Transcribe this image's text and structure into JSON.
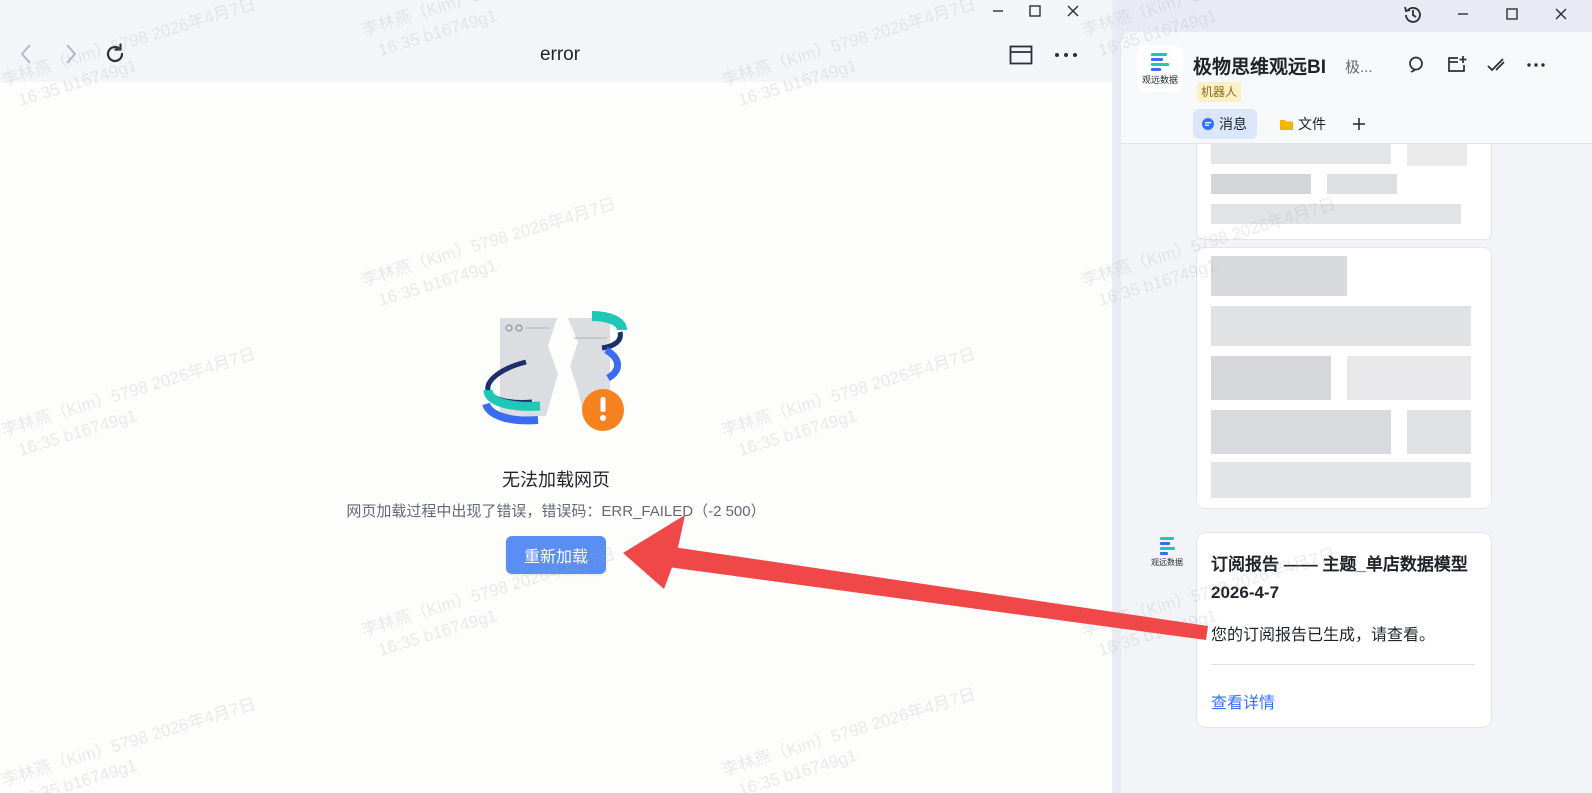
{
  "browser": {
    "page_title": "error",
    "error_title": "无法加载网页",
    "error_desc": "网页加载过程中出现了错误，错误码：ERR_FAILED（-2 500）",
    "reload_label": "重新加载"
  },
  "chat": {
    "name": "极物思维观远BI",
    "name_extra": "极...",
    "robot_badge": "机器人",
    "logo_text": "观远数据",
    "tabs": [
      {
        "label": "消息"
      },
      {
        "label": "文件"
      }
    ],
    "report_card": {
      "title": "订阅报告 —— 主题_单店数据模型 2026-4-7",
      "body": "您的订阅报告已生成，请查看。",
      "link": "查看详情"
    }
  },
  "watermark": {
    "line1": "李林燕（Kim）5798 2026年4月7日",
    "line2": "16:35 b16749g1"
  },
  "colors": {
    "accent": "#5b8ef3",
    "link": "#3370ff",
    "arrow": "#f04848",
    "warning": "#f5821f",
    "teal": "#1fc7b6"
  }
}
